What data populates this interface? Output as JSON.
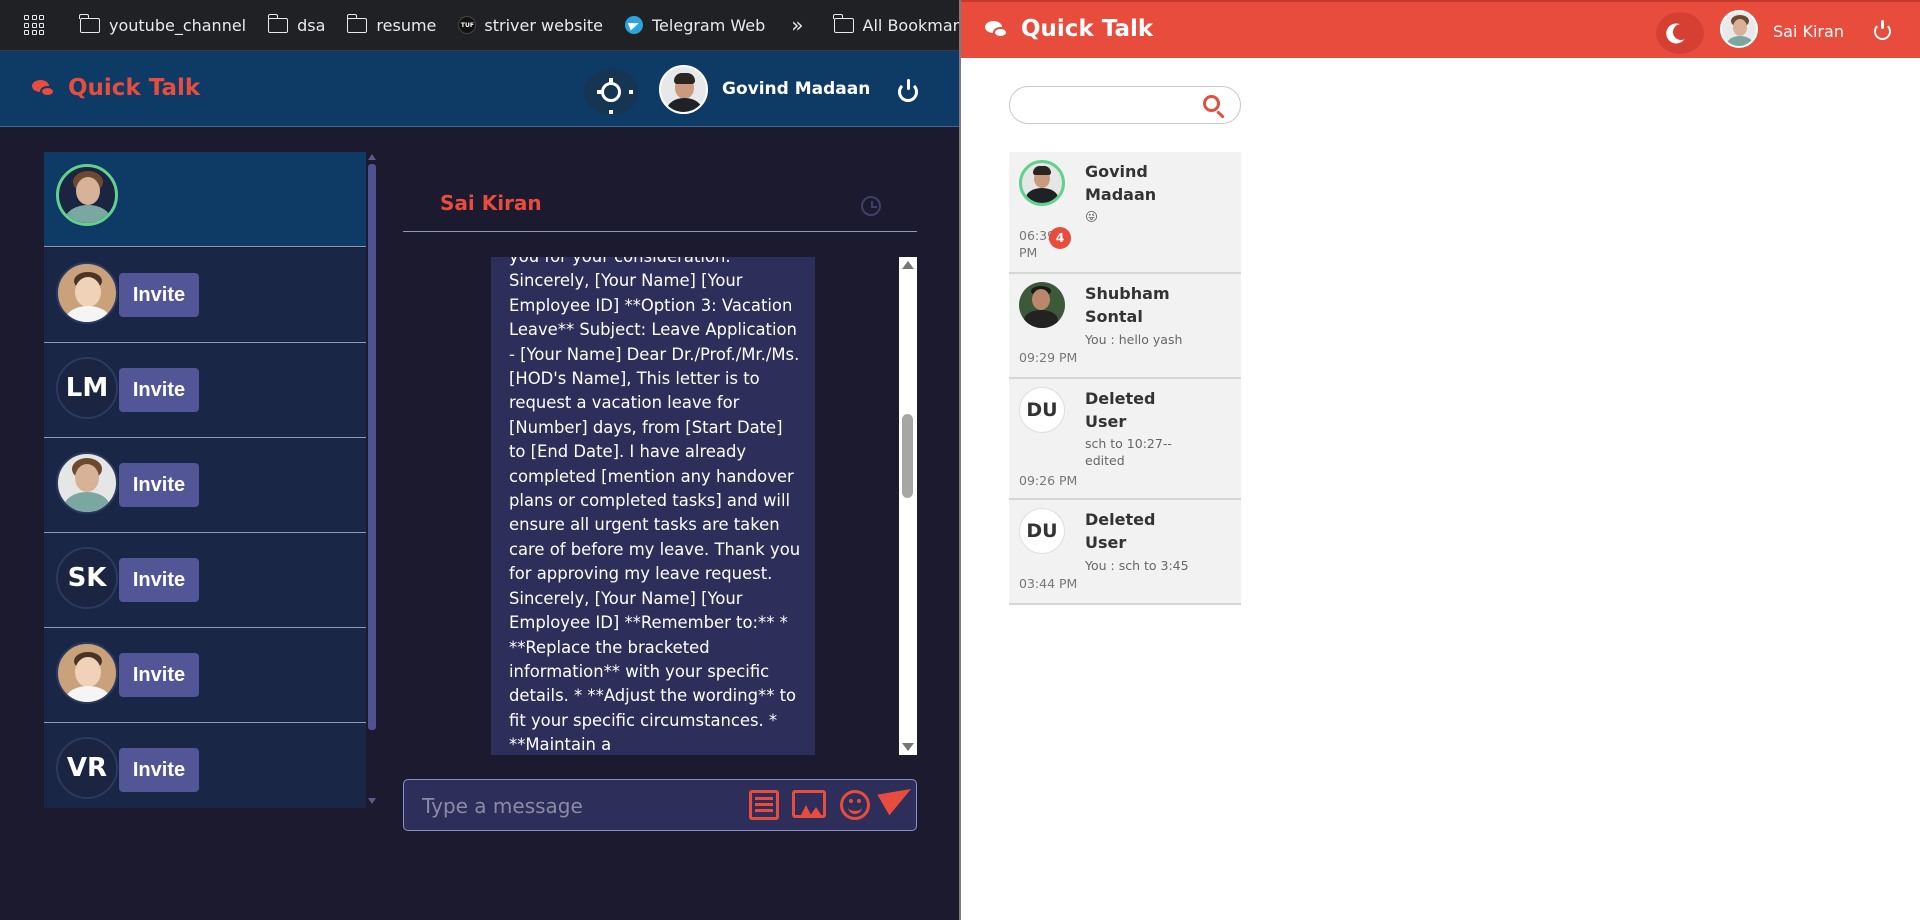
{
  "bookmarks_bar": {
    "items": [
      {
        "label": "youtube_channel",
        "icon": "folder-icon"
      },
      {
        "label": "dsa",
        "icon": "folder-icon"
      },
      {
        "label": "resume",
        "icon": "folder-icon"
      },
      {
        "label": "striver website",
        "icon": "tuf-icon"
      },
      {
        "label": "Telegram Web",
        "icon": "telegram-icon"
      }
    ],
    "more_label": "»",
    "all_bookmarks_label": "All Bookmarks"
  },
  "dark_app": {
    "brand": "Quick Talk",
    "user_name": "Govind Madaan",
    "settings_icon": "gear-icon",
    "logout_icon": "power-icon",
    "contacts": [
      {
        "kind": "photo",
        "active": true,
        "invite": ""
      },
      {
        "kind": "photo",
        "active": false,
        "invite": "Invite"
      },
      {
        "kind": "initials",
        "initials": "LM",
        "active": false,
        "invite": "Invite"
      },
      {
        "kind": "photo",
        "active": false,
        "invite": "Invite"
      },
      {
        "kind": "initials",
        "initials": "SK",
        "active": false,
        "invite": "Invite"
      },
      {
        "kind": "photo",
        "active": false,
        "invite": "Invite"
      },
      {
        "kind": "initials",
        "initials": "VR",
        "active": false,
        "invite": "Invite"
      }
    ],
    "chat": {
      "contact_name": "Sai Kiran",
      "message_text": "you for your consideration. Sincerely, [Your Name] [Your Employee ID] **Option 3: Vacation Leave** Subject: Leave Application - [Your Name] Dear Dr./Prof./Mr./Ms. [HOD's Name], This letter is to request a vacation leave for [Number] days, from [Start Date] to [End Date]. I have already completed [mention any handover plans or completed tasks] and will ensure all urgent tasks are taken care of before my leave. Thank you for approving my leave request. Sincerely, [Your Name] [Your Employee ID] **Remember to:** * **Replace the bracketed information** with your specific details. * **Adjust the wording** to fit your specific circumstances. * **Maintain a",
      "input_placeholder": "Type a message"
    },
    "colors": {
      "accent": "#e84c3d",
      "header": "#0e3a66",
      "bubble": "#2e2e5a",
      "invite": "#525596",
      "online": "#61d18e"
    }
  },
  "light_app": {
    "brand": "Quick Talk",
    "user_name": "Sai Kiran",
    "theme_icon": "moon-icon",
    "logout_icon": "power-icon",
    "search": {
      "placeholder": "",
      "value": ""
    },
    "conversations": [
      {
        "name": "Govind Madaan",
        "last_message": "😜",
        "time": "06:39 PM",
        "unread": "4",
        "online": true,
        "kind": "photo"
      },
      {
        "name": "Shubham Sontal",
        "last_message": "You : hello yash",
        "time": "09:29 PM",
        "unread": "",
        "online": false,
        "kind": "photo"
      },
      {
        "name": "Deleted User",
        "initials": "DU",
        "last_message": "sch to 10:27-- edited",
        "time": "09:26 PM",
        "unread": "",
        "online": false,
        "kind": "initials"
      },
      {
        "name": "Deleted User",
        "initials": "DU",
        "last_message": "You : sch to 3:45",
        "time": "03:44 PM",
        "unread": "",
        "online": false,
        "kind": "initials"
      }
    ],
    "colors": {
      "accent": "#e84c3d",
      "item_bg": "#f2f2f2"
    }
  }
}
